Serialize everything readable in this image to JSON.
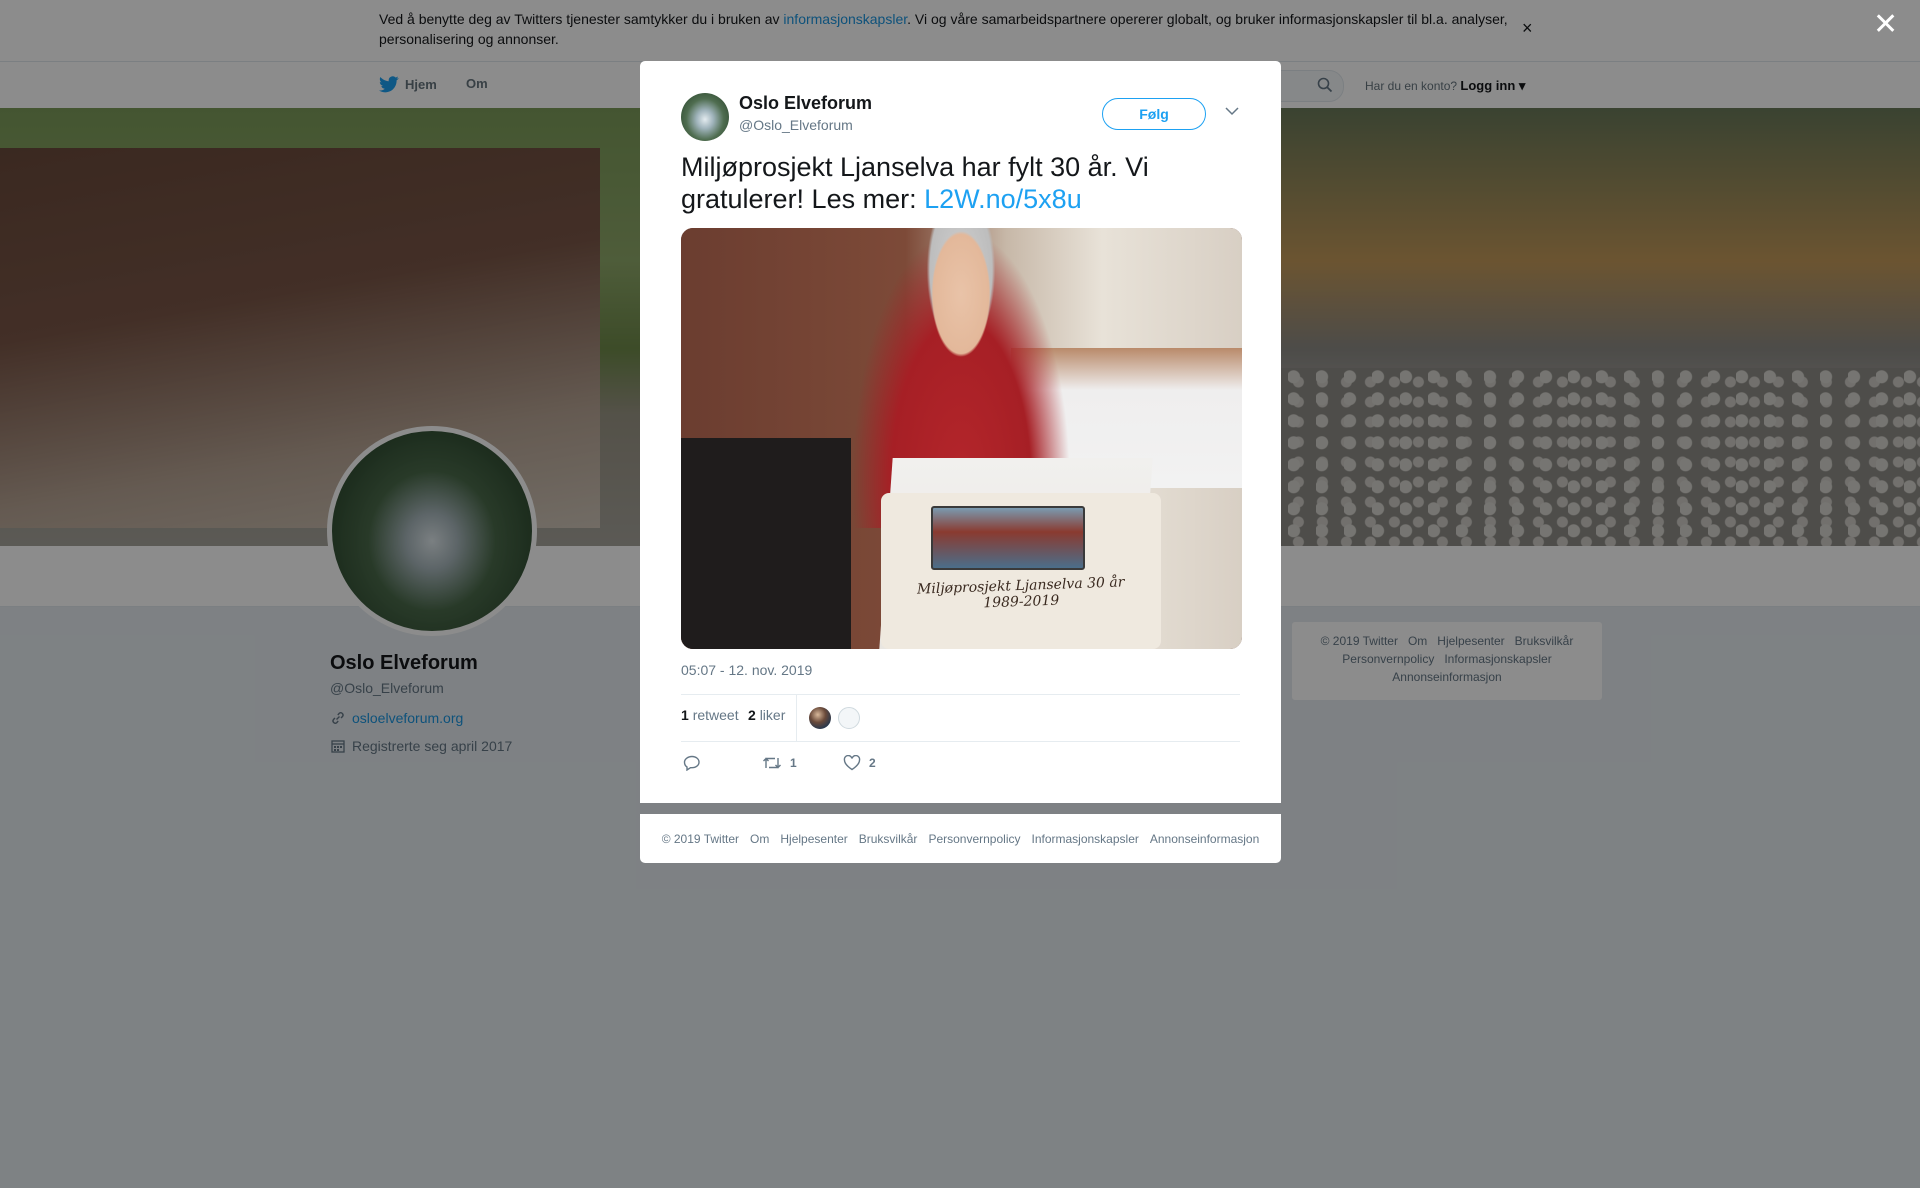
{
  "cookie_bar": {
    "text_before": "Ved å benytte deg av Twitters tjenester samtykker du i bruken av ",
    "link": "informasjonskapsler",
    "text_after": ". Vi og våre samarbeidspartnere opererer globalt, og bruker informasjonskapsler til bl.a. analyser, personalisering og annonser.",
    "close": "×"
  },
  "nav": {
    "home": "Hjem",
    "about": "Om",
    "have_account": "Har du en konto?",
    "login": "Logg inn"
  },
  "profile": {
    "name": "Oslo Elveforum",
    "handle": "@Oslo_Elveforum",
    "website": "osloelveforum.org",
    "joined": "Registrerte seg april 2017"
  },
  "side_footer": {
    "line1": [
      "© 2019 Twitter",
      "Om",
      "Hjelpesenter",
      "Bruksvilkår"
    ],
    "line2": [
      "Personvernpolicy",
      "Informasjonskapsler"
    ],
    "line3": [
      "Annonseinformasjon"
    ]
  },
  "overlay_close": "✕",
  "tweet": {
    "author_name": "Oslo Elveforum",
    "author_handle": "@Oslo_Elveforum",
    "follow_label": "Følg",
    "text": "Miljøprosjekt Ljanselva har fylt 30 år. Vi gratulerer! Les mer: ",
    "link": "L2W.no/5x8u",
    "photo_cake_text_1": "Miljøprosjekt Ljanselva 30 år",
    "photo_cake_text_2": "1989-2019",
    "timestamp": "05:07 - 12. nov. 2019",
    "retweets_count": "1",
    "retweets_label": "retweet",
    "likes_count": "2",
    "likes_label": "liker",
    "action_retweet_count": "1",
    "action_like_count": "2"
  },
  "modal_footer": [
    "© 2019 Twitter",
    "Om",
    "Hjelpesenter",
    "Bruksvilkår",
    "Personvernpolicy",
    "Informasjonskapsler",
    "Annonseinformasjon"
  ],
  "colors": {
    "accent": "#1da1f2",
    "link": "#1b95e0",
    "muted_text": "#657786",
    "overlay": "rgba(0,0,0,0.45)"
  },
  "icons": [
    "twitter-bird-icon",
    "search-icon",
    "link-icon",
    "calendar-icon",
    "chevron-down-icon",
    "reply-icon",
    "retweet-icon",
    "heart-icon",
    "close-icon"
  ]
}
